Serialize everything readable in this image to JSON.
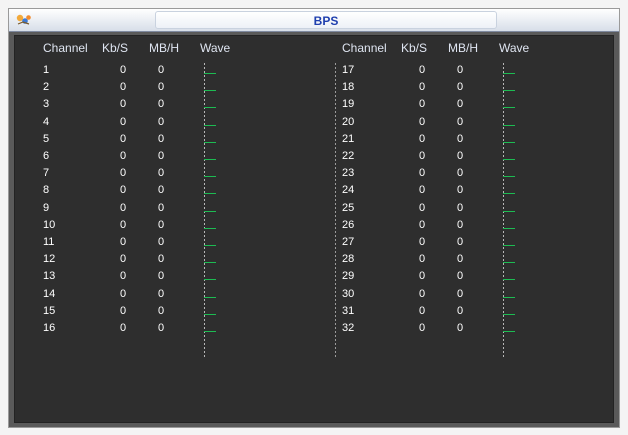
{
  "window": {
    "title": "BPS"
  },
  "headers": {
    "channel": "Channel",
    "kbs": "Kb/S",
    "mbh": "MB/H",
    "wave": "Wave"
  },
  "left_rows": [
    {
      "channel": "1",
      "kbs": "0",
      "mbh": "0"
    },
    {
      "channel": "2",
      "kbs": "0",
      "mbh": "0"
    },
    {
      "channel": "3",
      "kbs": "0",
      "mbh": "0"
    },
    {
      "channel": "4",
      "kbs": "0",
      "mbh": "0"
    },
    {
      "channel": "5",
      "kbs": "0",
      "mbh": "0"
    },
    {
      "channel": "6",
      "kbs": "0",
      "mbh": "0"
    },
    {
      "channel": "7",
      "kbs": "0",
      "mbh": "0"
    },
    {
      "channel": "8",
      "kbs": "0",
      "mbh": "0"
    },
    {
      "channel": "9",
      "kbs": "0",
      "mbh": "0"
    },
    {
      "channel": "10",
      "kbs": "0",
      "mbh": "0"
    },
    {
      "channel": "11",
      "kbs": "0",
      "mbh": "0"
    },
    {
      "channel": "12",
      "kbs": "0",
      "mbh": "0"
    },
    {
      "channel": "13",
      "kbs": "0",
      "mbh": "0"
    },
    {
      "channel": "14",
      "kbs": "0",
      "mbh": "0"
    },
    {
      "channel": "15",
      "kbs": "0",
      "mbh": "0"
    },
    {
      "channel": "16",
      "kbs": "0",
      "mbh": "0"
    }
  ],
  "right_rows": [
    {
      "channel": "17",
      "kbs": "0",
      "mbh": "0"
    },
    {
      "channel": "18",
      "kbs": "0",
      "mbh": "0"
    },
    {
      "channel": "19",
      "kbs": "0",
      "mbh": "0"
    },
    {
      "channel": "20",
      "kbs": "0",
      "mbh": "0"
    },
    {
      "channel": "21",
      "kbs": "0",
      "mbh": "0"
    },
    {
      "channel": "22",
      "kbs": "0",
      "mbh": "0"
    },
    {
      "channel": "23",
      "kbs": "0",
      "mbh": "0"
    },
    {
      "channel": "24",
      "kbs": "0",
      "mbh": "0"
    },
    {
      "channel": "25",
      "kbs": "0",
      "mbh": "0"
    },
    {
      "channel": "26",
      "kbs": "0",
      "mbh": "0"
    },
    {
      "channel": "27",
      "kbs": "0",
      "mbh": "0"
    },
    {
      "channel": "28",
      "kbs": "0",
      "mbh": "0"
    },
    {
      "channel": "29",
      "kbs": "0",
      "mbh": "0"
    },
    {
      "channel": "30",
      "kbs": "0",
      "mbh": "0"
    },
    {
      "channel": "31",
      "kbs": "0",
      "mbh": "0"
    },
    {
      "channel": "32",
      "kbs": "0",
      "mbh": "0"
    }
  ],
  "colors": {
    "wave": "#1dbb52",
    "text": "#ffffff",
    "title": "#1f3fae"
  },
  "icons": {
    "app": "logo-icon"
  }
}
